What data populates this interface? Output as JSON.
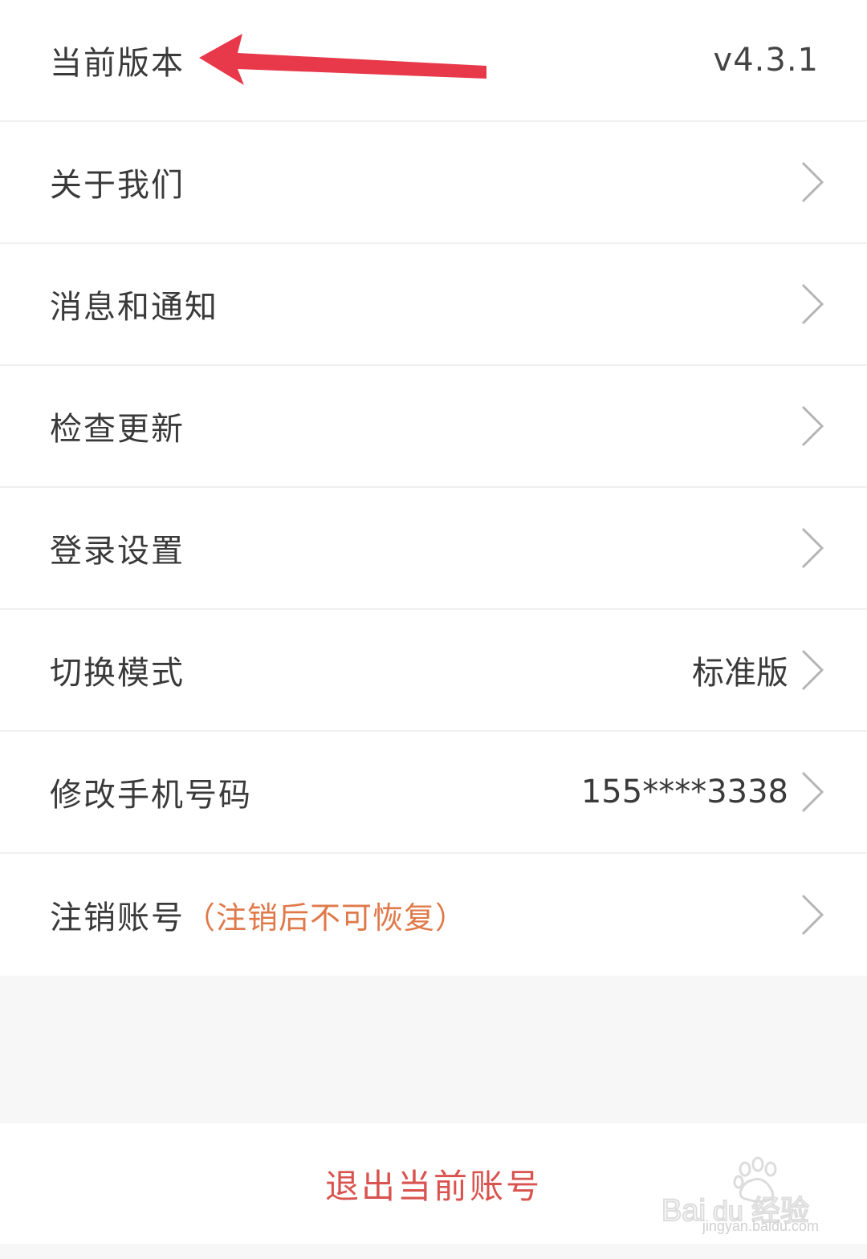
{
  "settings": {
    "items": [
      {
        "label": "当前版本",
        "value": "v4.3.1"
      },
      {
        "label": "关于我们"
      },
      {
        "label": "消息和通知"
      },
      {
        "label": "检查更新"
      },
      {
        "label": "登录设置"
      },
      {
        "label": "切换模式",
        "value": "标准版"
      },
      {
        "label": "修改手机号码",
        "value": "155****3338"
      },
      {
        "label": "注销账号",
        "note": "（注销后不可恢复）"
      }
    ]
  },
  "logout": {
    "label": "退出当前账号"
  },
  "watermark": {
    "brand": "Baidu经验",
    "url": "jingyan.baidu.com"
  },
  "colors": {
    "accent": "#d9534f",
    "warning": "#e0794a",
    "annotation_arrow": "#e8394a"
  }
}
